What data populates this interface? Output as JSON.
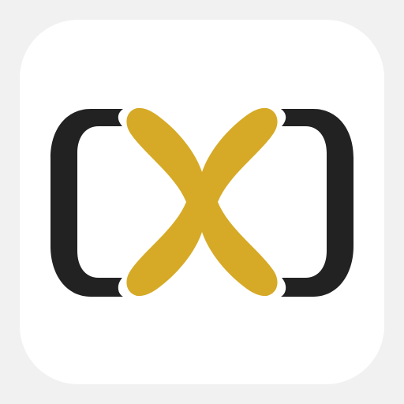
{
  "app_icon": {
    "icon": "bracket-x-logo-icon",
    "colors": {
      "canvas_background": "#f1f1f1",
      "tile_background": "#ffffff",
      "bracket": "#222222",
      "x_mark": "#d6aa26"
    }
  }
}
